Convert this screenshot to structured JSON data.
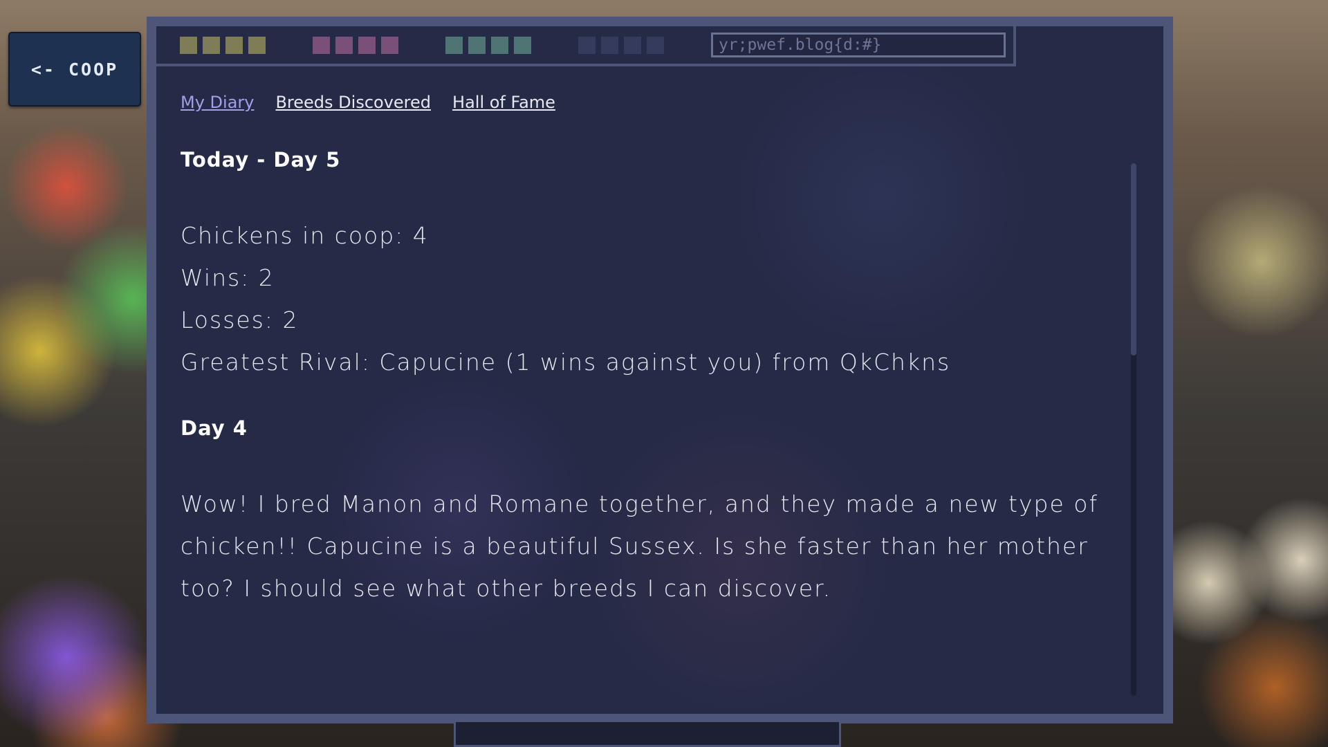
{
  "back_button": {
    "label": "<- COOP"
  },
  "toolbar": {
    "url": "yr;pwef.blog{d:#}",
    "swatch_groups": [
      {
        "name": "olive",
        "colors": [
          "#7f7d55",
          "#7f7d55",
          "#7f7d55",
          "#7f7d55"
        ]
      },
      {
        "name": "mauve",
        "colors": [
          "#7a4f78",
          "#7a4f78",
          "#7a4f78",
          "#7a4f78"
        ]
      },
      {
        "name": "teal",
        "colors": [
          "#4f7474",
          "#4f7474",
          "#4f7474",
          "#4f7474"
        ]
      },
      {
        "name": "slate",
        "colors": [
          "#353b5c",
          "#353b5c",
          "#353b5c",
          "#353b5c"
        ]
      }
    ]
  },
  "nav": {
    "my_diary": "My Diary",
    "breeds_discovered": "Breeds Discovered",
    "hall_of_fame": "Hall of Fame",
    "active": "My Diary"
  },
  "diary": {
    "day5": {
      "title": "Today - Day 5",
      "chickens": "Chickens in coop: 4",
      "wins": "Wins: 2",
      "losses": "Losses: 2",
      "rival": "Greatest Rival: Capucine (1 wins against you) from QkChkns"
    },
    "day4": {
      "title": "Day 4",
      "body": "Wow! I bred Manon and Romane together, and they made a new type of chicken!! Capucine is a beautiful Sussex. Is she faster than her mother too? I should see what other breeds I can discover."
    }
  },
  "colors": {
    "window_frame": "#4d5679",
    "window_bg": "#252a46",
    "active_link": "#a59ee8",
    "back_button_bg": "#1e3150"
  }
}
